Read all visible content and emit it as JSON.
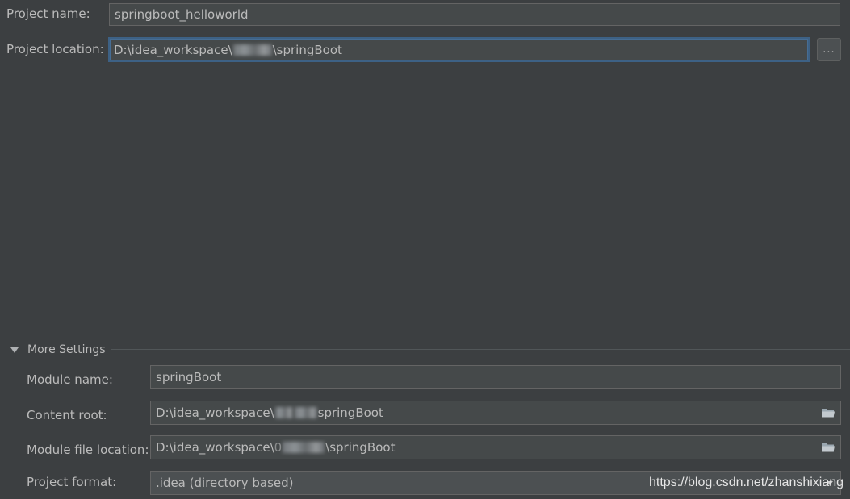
{
  "project": {
    "name_label": "Project name:",
    "name_value": "springboot_helloworld",
    "location_label": "Project location:",
    "location_prefix": "D:\\idea_workspace\\",
    "location_suffix": "\\springBoot",
    "browse_label": "..."
  },
  "more_settings": {
    "title": "More Settings",
    "module_name_label": "Module name:",
    "module_name_value": "springBoot",
    "content_root_label": "Content root:",
    "content_root_prefix": "D:\\idea_workspace\\",
    "content_root_suffix": "springBoot",
    "module_file_label": "Module file location:",
    "module_file_prefix": "D:\\idea_workspace\\",
    "module_file_fragment": "0",
    "module_file_suffix": "\\springBoot",
    "project_format_label": "Project format:",
    "project_format_value": ".idea (directory based)"
  },
  "watermark": "https://blog.csdn.net/zhanshixiang",
  "icons": {
    "folder": "folder-icon",
    "expand": "triangle-down-icon",
    "dropdown": "chevron-down-icon"
  },
  "colors": {
    "background": "#3c3f41",
    "field_background": "#45494a",
    "focus_border": "#3d6185",
    "text": "#bbbbbb"
  }
}
